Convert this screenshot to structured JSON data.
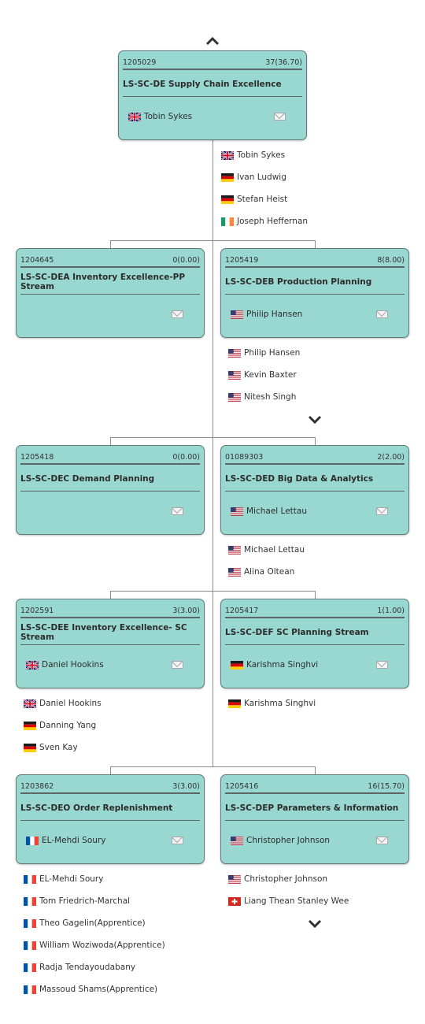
{
  "root": {
    "code": "1205029",
    "count": "37(36.70)",
    "title": "LS-SC-DE Supply Chain Excellence",
    "manager": "Tobin Sykes",
    "manager_flag": "gb",
    "members": [
      {
        "name": "Tobin Sykes",
        "flag": "gb"
      },
      {
        "name": "Ivan Ludwig",
        "flag": "de"
      },
      {
        "name": "Stefan Heist",
        "flag": "de"
      },
      {
        "name": "Joseph Heffernan",
        "flag": "ie"
      }
    ]
  },
  "units": [
    {
      "code": "1204645",
      "count": "0(0.00)",
      "title": "LS-SC-DEA Inventory Excellence-PP Stream",
      "manager": "",
      "manager_flag": "",
      "members": []
    },
    {
      "code": "1205419",
      "count": "8(8.00)",
      "title": "LS-SC-DEB Production Planning",
      "manager": "Philip Hansen",
      "manager_flag": "us",
      "members": [
        {
          "name": "Philip Hansen",
          "flag": "us"
        },
        {
          "name": "Kevin Baxter",
          "flag": "us"
        },
        {
          "name": "Nitesh Singh",
          "flag": "us"
        }
      ]
    },
    {
      "code": "1205418",
      "count": "0(0.00)",
      "title": "LS-SC-DEC Demand Planning",
      "manager": "",
      "manager_flag": "",
      "members": []
    },
    {
      "code": "01089303",
      "count": "2(2.00)",
      "title": "LS-SC-DED Big Data & Analytics",
      "manager": "Michael Lettau",
      "manager_flag": "us",
      "members": [
        {
          "name": "Michael Lettau",
          "flag": "us"
        },
        {
          "name": "Alina Oltean",
          "flag": "us"
        }
      ]
    },
    {
      "code": "1202591",
      "count": "3(3.00)",
      "title": "LS-SC-DEE Inventory Excellence- SC Stream",
      "manager": "Daniel Hookins",
      "manager_flag": "gb",
      "members": [
        {
          "name": "Daniel Hookins",
          "flag": "gb"
        },
        {
          "name": "Danning Yang",
          "flag": "de"
        },
        {
          "name": "Sven Kay",
          "flag": "de"
        }
      ]
    },
    {
      "code": "1205417",
      "count": "1(1.00)",
      "title": "LS-SC-DEF SC Planning Stream",
      "manager": "Karishma Singhvi",
      "manager_flag": "de",
      "members": [
        {
          "name": "Karishma Singhvi",
          "flag": "de"
        }
      ]
    },
    {
      "code": "1203862",
      "count": "3(3.00)",
      "title": "LS-SC-DEO Order Replenishment",
      "manager": "EL-Mehdi Soury",
      "manager_flag": "fr",
      "members": [
        {
          "name": "EL-Mehdi Soury",
          "flag": "fr"
        },
        {
          "name": "Tom Friedrich-Marchal",
          "flag": "fr"
        },
        {
          "name": "Theo Gagelin(Apprentice)",
          "flag": "fr"
        },
        {
          "name": "William Woziwoda(Apprentice)",
          "flag": "fr"
        },
        {
          "name": "Radja Tendayoudabany",
          "flag": "fr"
        },
        {
          "name": "Massoud Shams(Apprentice)",
          "flag": "fr"
        }
      ]
    },
    {
      "code": "1205416",
      "count": "16(15.70)",
      "title": "LS-SC-DEP Parameters & Information",
      "manager": "Christopher Johnson",
      "manager_flag": "us",
      "members": [
        {
          "name": "Christopher Johnson",
          "flag": "us"
        },
        {
          "name": "Liang Thean Stanley Wee",
          "flag": "ch"
        }
      ]
    }
  ],
  "icons": {
    "collapse_up": "chevron-up-icon",
    "expand_down": "chevron-down-icon",
    "mail": "mail-icon"
  },
  "colors": {
    "box_fill": "#99d8d0",
    "connector": "#8c8c8c"
  }
}
